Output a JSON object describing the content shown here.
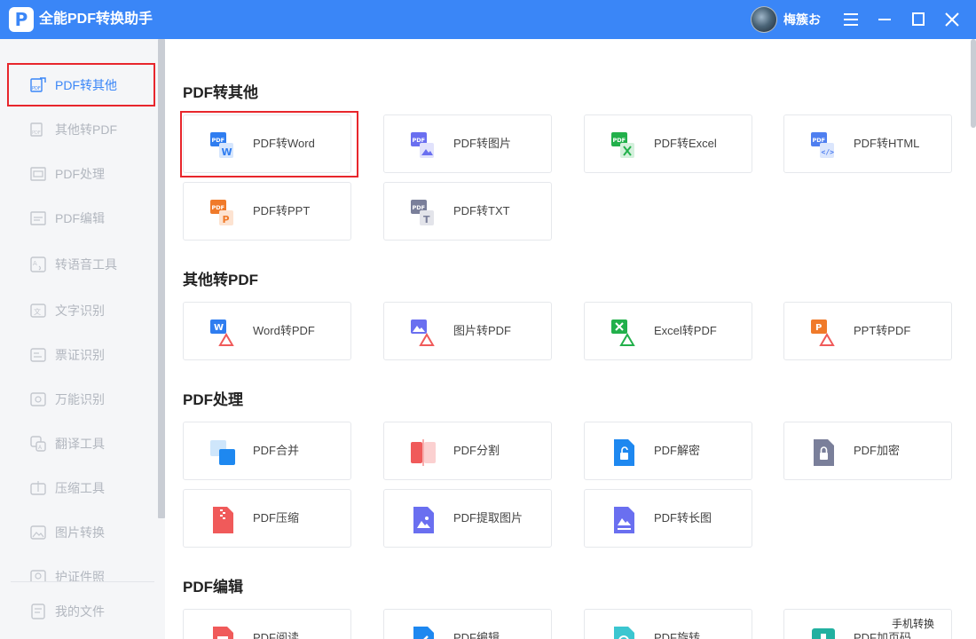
{
  "app": {
    "title": "全能PDF转换助手",
    "logo_letter": "P"
  },
  "user": {
    "name": "梅簇お"
  },
  "window": {
    "menu_icon": "menu-icon",
    "minimize_icon": "minimize-icon",
    "maximize_icon": "maximize-icon",
    "close_icon": "close-icon"
  },
  "sidebar": {
    "items": [
      {
        "label": "PDF转其他",
        "icon": "pdf-convert-icon",
        "active": true
      },
      {
        "label": "其他转PDF",
        "icon": "to-pdf-icon"
      },
      {
        "label": "PDF处理",
        "icon": "pdf-process-icon"
      },
      {
        "label": "PDF编辑",
        "icon": "pdf-edit-icon"
      },
      {
        "label": "转语音工具",
        "icon": "speech-icon"
      },
      {
        "label": "文字识别",
        "icon": "ocr-icon"
      },
      {
        "label": "票证识别",
        "icon": "ticket-icon"
      },
      {
        "label": "万能识别",
        "icon": "universal-recognize-icon"
      },
      {
        "label": "翻译工具",
        "icon": "translate-icon"
      },
      {
        "label": "压缩工具",
        "icon": "compress-icon"
      },
      {
        "label": "图片转换",
        "icon": "image-convert-icon"
      },
      {
        "label": "护证件照",
        "icon": "id-photo-icon"
      }
    ],
    "my_files": {
      "label": "我的文件",
      "icon": "my-files-icon"
    }
  },
  "sections": [
    {
      "title": "PDF转其他",
      "cards": [
        {
          "label": "PDF转Word",
          "icon": "pdf-to-word-icon",
          "color": "#2f7df0"
        },
        {
          "label": "PDF转图片",
          "icon": "pdf-to-image-icon",
          "color": "#6a6ff0"
        },
        {
          "label": "PDF转Excel",
          "icon": "pdf-to-excel-icon",
          "color": "#22b04b"
        },
        {
          "label": "PDF转HTML",
          "icon": "pdf-to-html-icon",
          "color": "#4f7ff0"
        },
        {
          "label": "PDF转PPT",
          "icon": "pdf-to-ppt-icon",
          "color": "#f07a2a"
        },
        {
          "label": "PDF转TXT",
          "icon": "pdf-to-txt-icon",
          "color": "#7a7f9a"
        }
      ]
    },
    {
      "title": "其他转PDF",
      "cards": [
        {
          "label": "Word转PDF",
          "icon": "word-to-pdf-icon",
          "color": "#2f7df0"
        },
        {
          "label": "图片转PDF",
          "icon": "image-to-pdf-icon",
          "color": "#6a6ff0"
        },
        {
          "label": "Excel转PDF",
          "icon": "excel-to-pdf-icon",
          "color": "#22b04b"
        },
        {
          "label": "PPT转PDF",
          "icon": "ppt-to-pdf-icon",
          "color": "#f07a2a"
        }
      ]
    },
    {
      "title": "PDF处理",
      "cards": [
        {
          "label": "PDF合并",
          "icon": "pdf-merge-icon",
          "color": "#1e88f0"
        },
        {
          "label": "PDF分割",
          "icon": "pdf-split-icon",
          "color": "#f05a5a"
        },
        {
          "label": "PDF解密",
          "icon": "pdf-decrypt-icon",
          "color": "#1e88f0"
        },
        {
          "label": "PDF加密",
          "icon": "pdf-encrypt-icon",
          "color": "#7a7f9a"
        },
        {
          "label": "PDF压缩",
          "icon": "pdf-compress-icon",
          "color": "#f05a5a"
        },
        {
          "label": "PDF提取图片",
          "icon": "pdf-extract-image-icon",
          "color": "#6a6ff0"
        },
        {
          "label": "PDF转长图",
          "icon": "pdf-long-image-icon",
          "color": "#6a6ff0"
        }
      ]
    },
    {
      "title": "PDF编辑",
      "cards": [
        {
          "label": "PDF阅读",
          "icon": "pdf-read-icon",
          "color": "#f05a5a"
        },
        {
          "label": "PDF编辑",
          "icon": "pdf-edit-card-icon",
          "color": "#1e88f0"
        },
        {
          "label": "PDF旋转",
          "icon": "pdf-rotate-icon",
          "color": "#3cc6d0"
        },
        {
          "label": "PDF加页码",
          "icon": "pdf-page-number-icon",
          "color": "#22b0a0"
        }
      ]
    }
  ],
  "phone_convert": {
    "label": "手机转换"
  }
}
